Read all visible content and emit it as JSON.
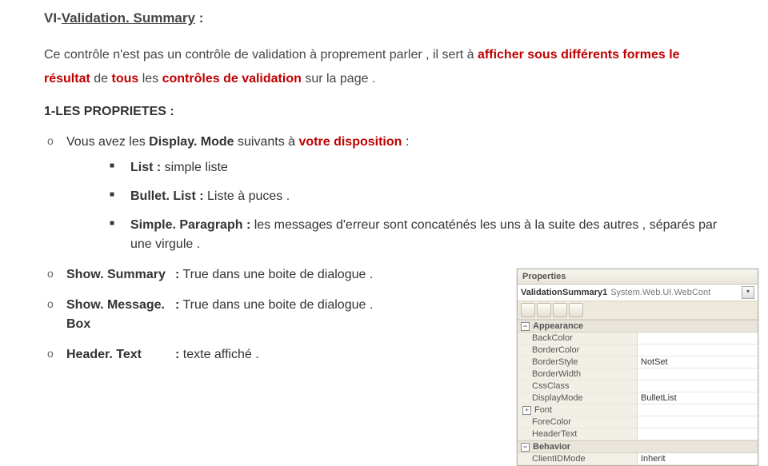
{
  "title_prefix": "VI-",
  "title_main": "Validation. Summary",
  "title_suffix": " :",
  "para1_a": "Ce contrôle n'est pas un contrôle de validation à proprement parler , il sert à ",
  "para1_red1": "afficher sous",
  "para1_red2": "différents formes le résultat",
  "para1_b": " de ",
  "para1_red3": "tous",
  "para1_c": " les ",
  "para1_red4": "contrôles de validation",
  "para1_d": " sur la page .",
  "section1": "1-LES PROPRIETES :",
  "intro_a": "Vous avez les ",
  "intro_b": "Display. Mode",
  "intro_c": " suivants à ",
  "intro_red": "votre disposition",
  "intro_d": "  :",
  "dm_list_label": "List :",
  "dm_list_text": " simple liste",
  "dm_bullet_label": "Bullet. List :",
  "dm_bullet_text": " Liste à puces .",
  "dm_sp_label": "Simple. Paragraph :",
  "dm_sp_text": " les messages d'erreur sont concaténés les uns à la suite des autres , séparés par une virgule .",
  "p_showsummary": "Show. Summary",
  "p_showsummary_v": ": True dans une boite de dialogue .",
  "p_showmsg": "Show. Message. Box",
  "p_showmsg_v": ": True dans une boite de dialogue .",
  "p_header": "Header. Text",
  "p_header_v": ": texte affiché  .",
  "panel": {
    "title": "Properties",
    "obj_name": "ValidationSummary1",
    "obj_type": "System.Web.UI.WebCont",
    "cat_appearance": "Appearance",
    "cat_behavior": "Behavior",
    "rows": [
      {
        "k": "BackColor",
        "v": ""
      },
      {
        "k": "BorderColor",
        "v": ""
      },
      {
        "k": "BorderStyle",
        "v": "NotSet"
      },
      {
        "k": "BorderWidth",
        "v": ""
      },
      {
        "k": "CssClass",
        "v": ""
      },
      {
        "k": "DisplayMode",
        "v": "BulletList"
      },
      {
        "k": "Font",
        "v": "",
        "exp": true
      },
      {
        "k": "ForeColor",
        "v": ""
      },
      {
        "k": "HeaderText",
        "v": ""
      }
    ],
    "behavior_rows": [
      {
        "k": "ClientIDMode",
        "v": "Inherit"
      }
    ]
  }
}
